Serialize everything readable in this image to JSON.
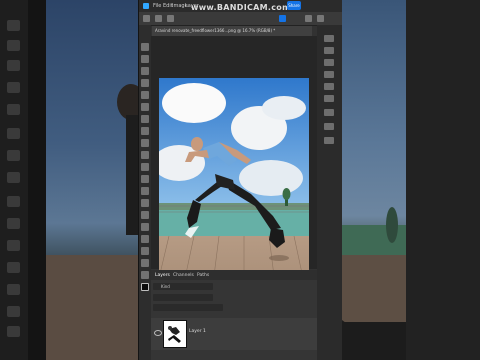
{
  "watermark": {
    "text": "www.BANDICAM.com"
  },
  "menu": {
    "items": [
      "File",
      "Edit",
      "Image",
      "Layer"
    ],
    "share_button": "Share"
  },
  "document": {
    "tab_title": "Aravind renovate_freedflower1366...png @ 16.7% (RGB/8) *"
  },
  "layers_panel": {
    "tabs": [
      "Layers",
      "Channels",
      "Paths"
    ],
    "filter_label": "Kind",
    "layer_name": "Layer 1"
  },
  "icons": [
    "info-icon",
    "move-tool-icon",
    "eye-icon"
  ],
  "colors": {
    "accent": "#1473e6",
    "panel": "#323232",
    "canvas_bg": "#262626"
  }
}
